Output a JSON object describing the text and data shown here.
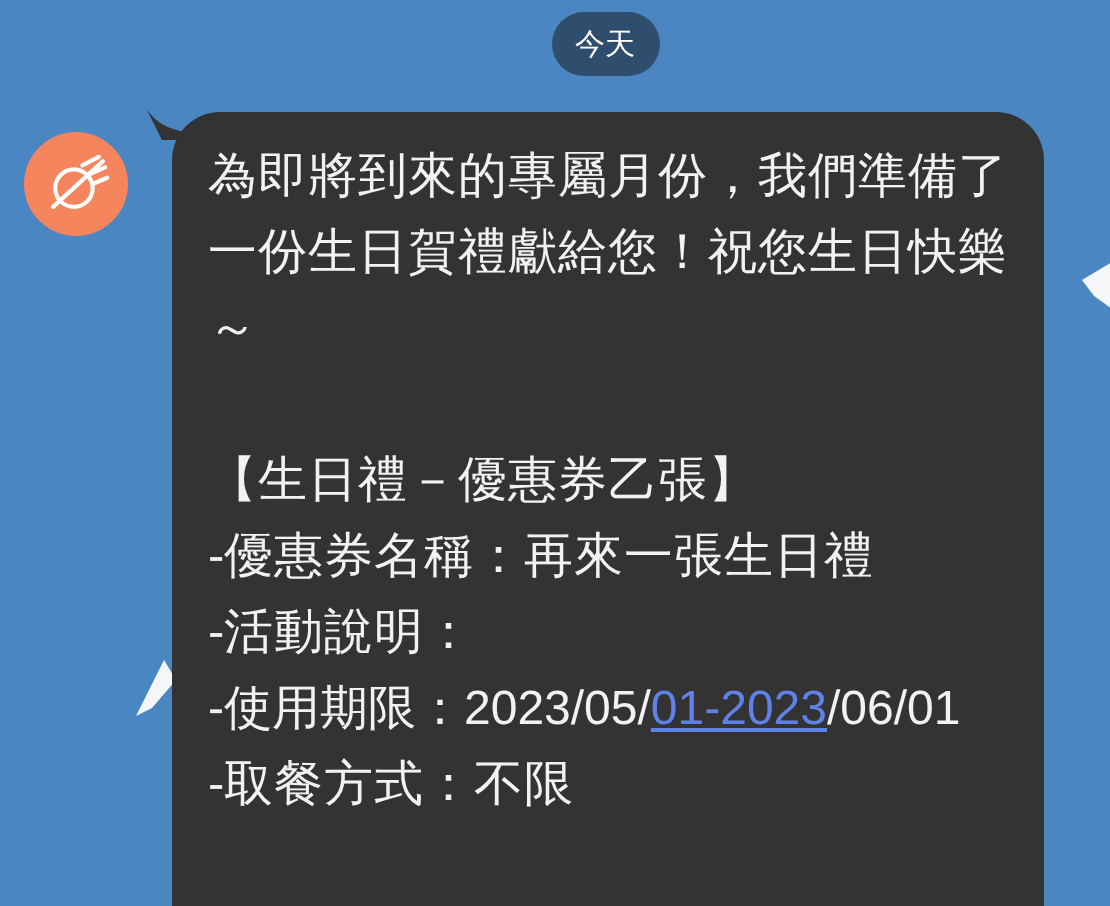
{
  "date_chip": "今天",
  "message": {
    "paragraphs": [
      {
        "kind": "text",
        "text": "為即將到來的專屬月份，我們準備了一份生日賀禮獻給您！祝您生日快樂～"
      },
      {
        "kind": "blank"
      },
      {
        "kind": "text",
        "text": "【生日禮－優惠券乙張】"
      },
      {
        "kind": "text",
        "text": "-優惠券名稱：再來一張生日禮"
      },
      {
        "kind": "text",
        "text": "-活動說明："
      },
      {
        "kind": "link",
        "before": "-使用期限：2023/05/",
        "link": "01-2023",
        "after": "/06/01"
      },
      {
        "kind": "text",
        "text": "-取餐方式：不限"
      }
    ]
  }
}
